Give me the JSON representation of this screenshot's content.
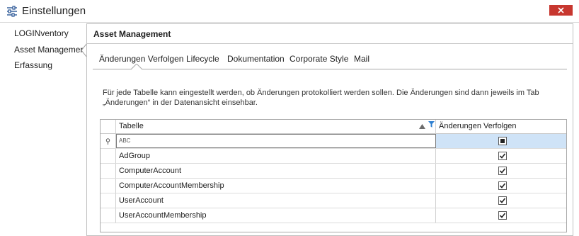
{
  "window": {
    "title": "Einstellungen",
    "icon": "settings-sliders-icon",
    "close_icon": "close-icon",
    "close_color": "#c7372f"
  },
  "nav": {
    "items": [
      {
        "label": "LOGINventory"
      },
      {
        "label": "Asset Management",
        "selected": true
      },
      {
        "label": "Erfassung"
      }
    ]
  },
  "panel": {
    "title": "Asset Management",
    "tabs": [
      {
        "label": "Änderungen Verfolgen",
        "selected": true
      },
      {
        "label": "Lifecycle"
      },
      {
        "label": "Dokumentation"
      },
      {
        "label": "Corporate Style"
      },
      {
        "label": "Mail"
      }
    ],
    "description_line1": "Für jede Tabelle kann eingestellt werden, ob Änderungen protokolliert werden sollen. Die Änderungen sind dann jeweils im Tab",
    "description_line2": "„Änderungen“ in der Datenansicht einsehbar."
  },
  "grid": {
    "columns": [
      "Tabelle",
      "Änderungen Verfolgen"
    ],
    "sort_icon": "sort-ascending-icon",
    "filter_icon": "filter-icon",
    "filter_row": {
      "text_placeholder": "ABC",
      "checkbox_state": "indeterminate",
      "selection_color": "#cfe3f7"
    },
    "rows": [
      {
        "name": "AdGroup",
        "tracked": true
      },
      {
        "name": "ComputerAccount",
        "tracked": true
      },
      {
        "name": "ComputerAccountMembership",
        "tracked": true
      },
      {
        "name": "UserAccount",
        "tracked": true
      },
      {
        "name": "UserAccountMembership",
        "tracked": true
      }
    ]
  }
}
